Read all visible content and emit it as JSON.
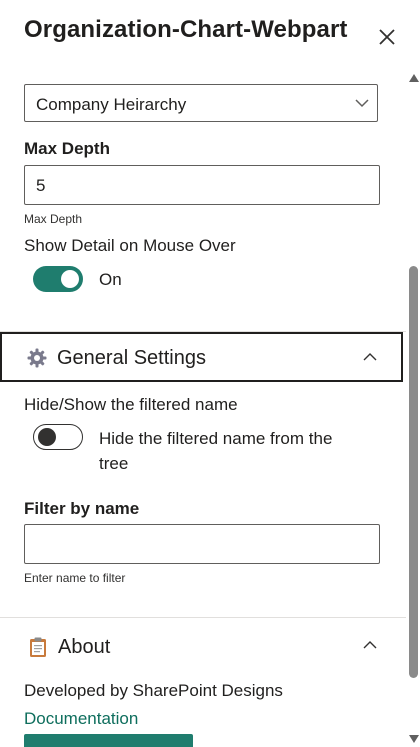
{
  "panel": {
    "title": "Organization-Chart-Webpart"
  },
  "dropdown": {
    "selected": "Company Heirarchy"
  },
  "max_depth": {
    "label": "Max Depth",
    "value": "5",
    "description": "Max Depth"
  },
  "show_detail": {
    "label": "Show Detail on Mouse Over",
    "toggle_text": "On",
    "toggle_on": true
  },
  "general_settings": {
    "title": "General Settings",
    "icon": "gear-icon",
    "expanded": true,
    "hide_show": {
      "label": "Hide/Show the filtered name",
      "toggle_text_line1": "Hide the filtered name from the",
      "toggle_text_line2": "tree",
      "toggle_on": false
    },
    "filter_by_name": {
      "label": "Filter by name",
      "value": "",
      "description": "Enter name to filter"
    }
  },
  "about": {
    "title": "About",
    "icon": "clipboard-icon",
    "expanded": true,
    "developed_by": "Developed by SharePoint Designs",
    "documentation_link": "Documentation"
  },
  "colors": {
    "accent": "#1f7d6e",
    "link": "#0e6e5d",
    "border": "#605e5c",
    "text": "#201f1e"
  }
}
